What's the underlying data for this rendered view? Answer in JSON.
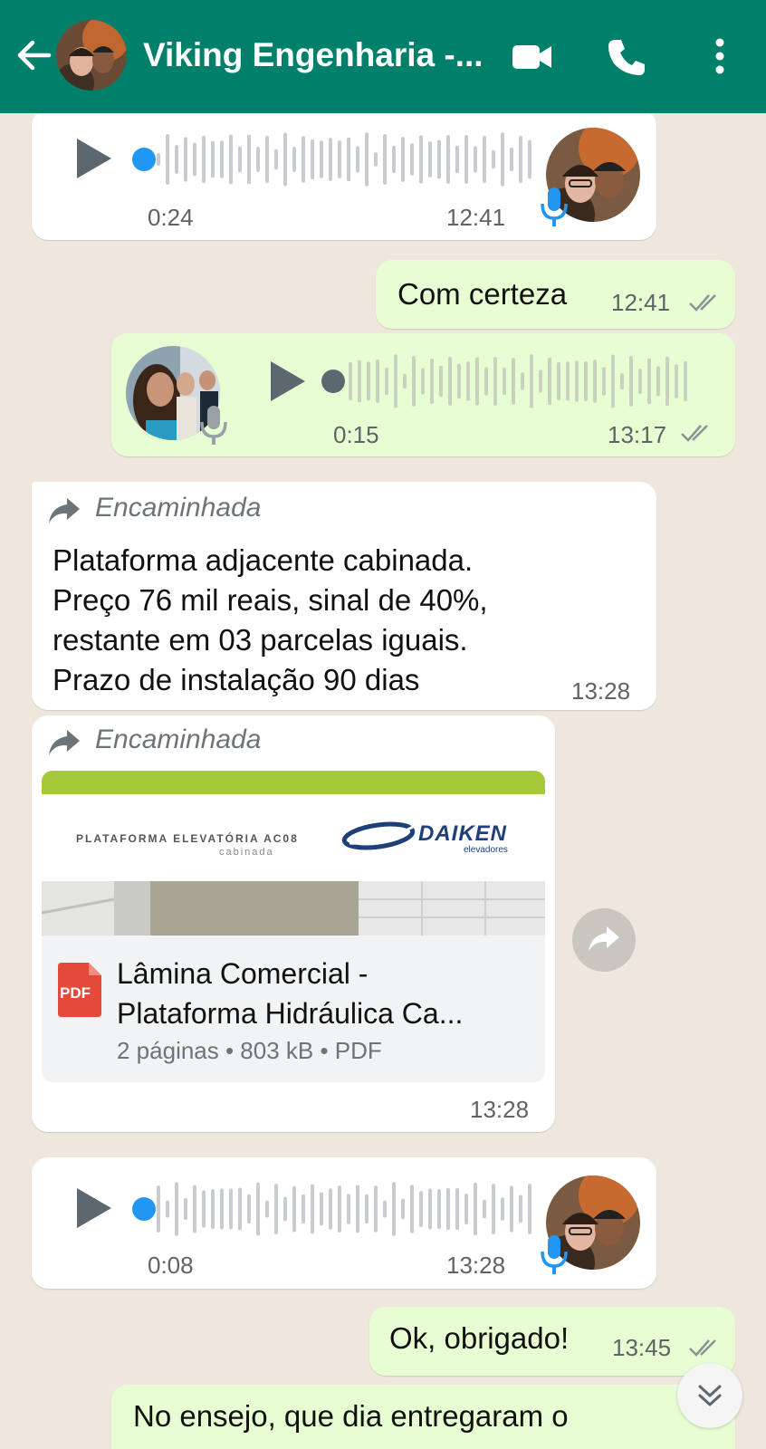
{
  "header": {
    "title": "Viking Engenharia -...",
    "colors": {
      "bar": "#00806a",
      "text": "#ffffff"
    },
    "icons": [
      "back-arrow-icon",
      "video-call-icon",
      "phone-icon",
      "more-options-icon"
    ]
  },
  "messages": [
    {
      "type": "voice",
      "direction": "in",
      "duration": "0:24",
      "time": "12:41"
    },
    {
      "type": "text",
      "direction": "out",
      "text": "Com certeza",
      "time": "12:41",
      "status": "read"
    },
    {
      "type": "voice",
      "direction": "out",
      "duration": "0:15",
      "time": "13:17",
      "status": "read"
    },
    {
      "type": "text",
      "direction": "in",
      "forwarded_label": "Encaminhada",
      "lines": [
        "Plataforma adjacente cabinada.",
        "Preço 76 mil reais, sinal de 40%,",
        "restante em 03 parcelas iguais.",
        "Prazo de instalação 90 dias"
      ],
      "time": "13:28"
    },
    {
      "type": "document",
      "direction": "in",
      "forwarded_label": "Encaminhada",
      "preview": {
        "heading": "PLATAFORMA ELEVATÓRIA AC08",
        "subheading": "cabinada",
        "brand": "DAIKEN",
        "brand_tagline": "elevadores"
      },
      "file_badge": "PDF",
      "file_name_line1": "Lâmina Comercial -",
      "file_name_line2": "Plataforma Hidráulica Ca...",
      "meta": "2 páginas • 803 kB • PDF",
      "time": "13:28"
    },
    {
      "type": "voice",
      "direction": "in",
      "duration": "0:08",
      "time": "13:28"
    },
    {
      "type": "text",
      "direction": "out",
      "text": "Ok, obrigado!",
      "time": "13:45",
      "status": "read"
    },
    {
      "type": "text",
      "direction": "out",
      "text": "No ensejo, que dia entregaram o",
      "partial": true
    }
  ],
  "colors": {
    "chat_bg": "#efe7de",
    "incoming": "#ffffff",
    "outgoing": "#e7fed2",
    "accent_blue": "#2196f3",
    "read_ticks": "#8a9299",
    "pdf_red": "#e5493a",
    "preview_green": "#a6c93a"
  }
}
